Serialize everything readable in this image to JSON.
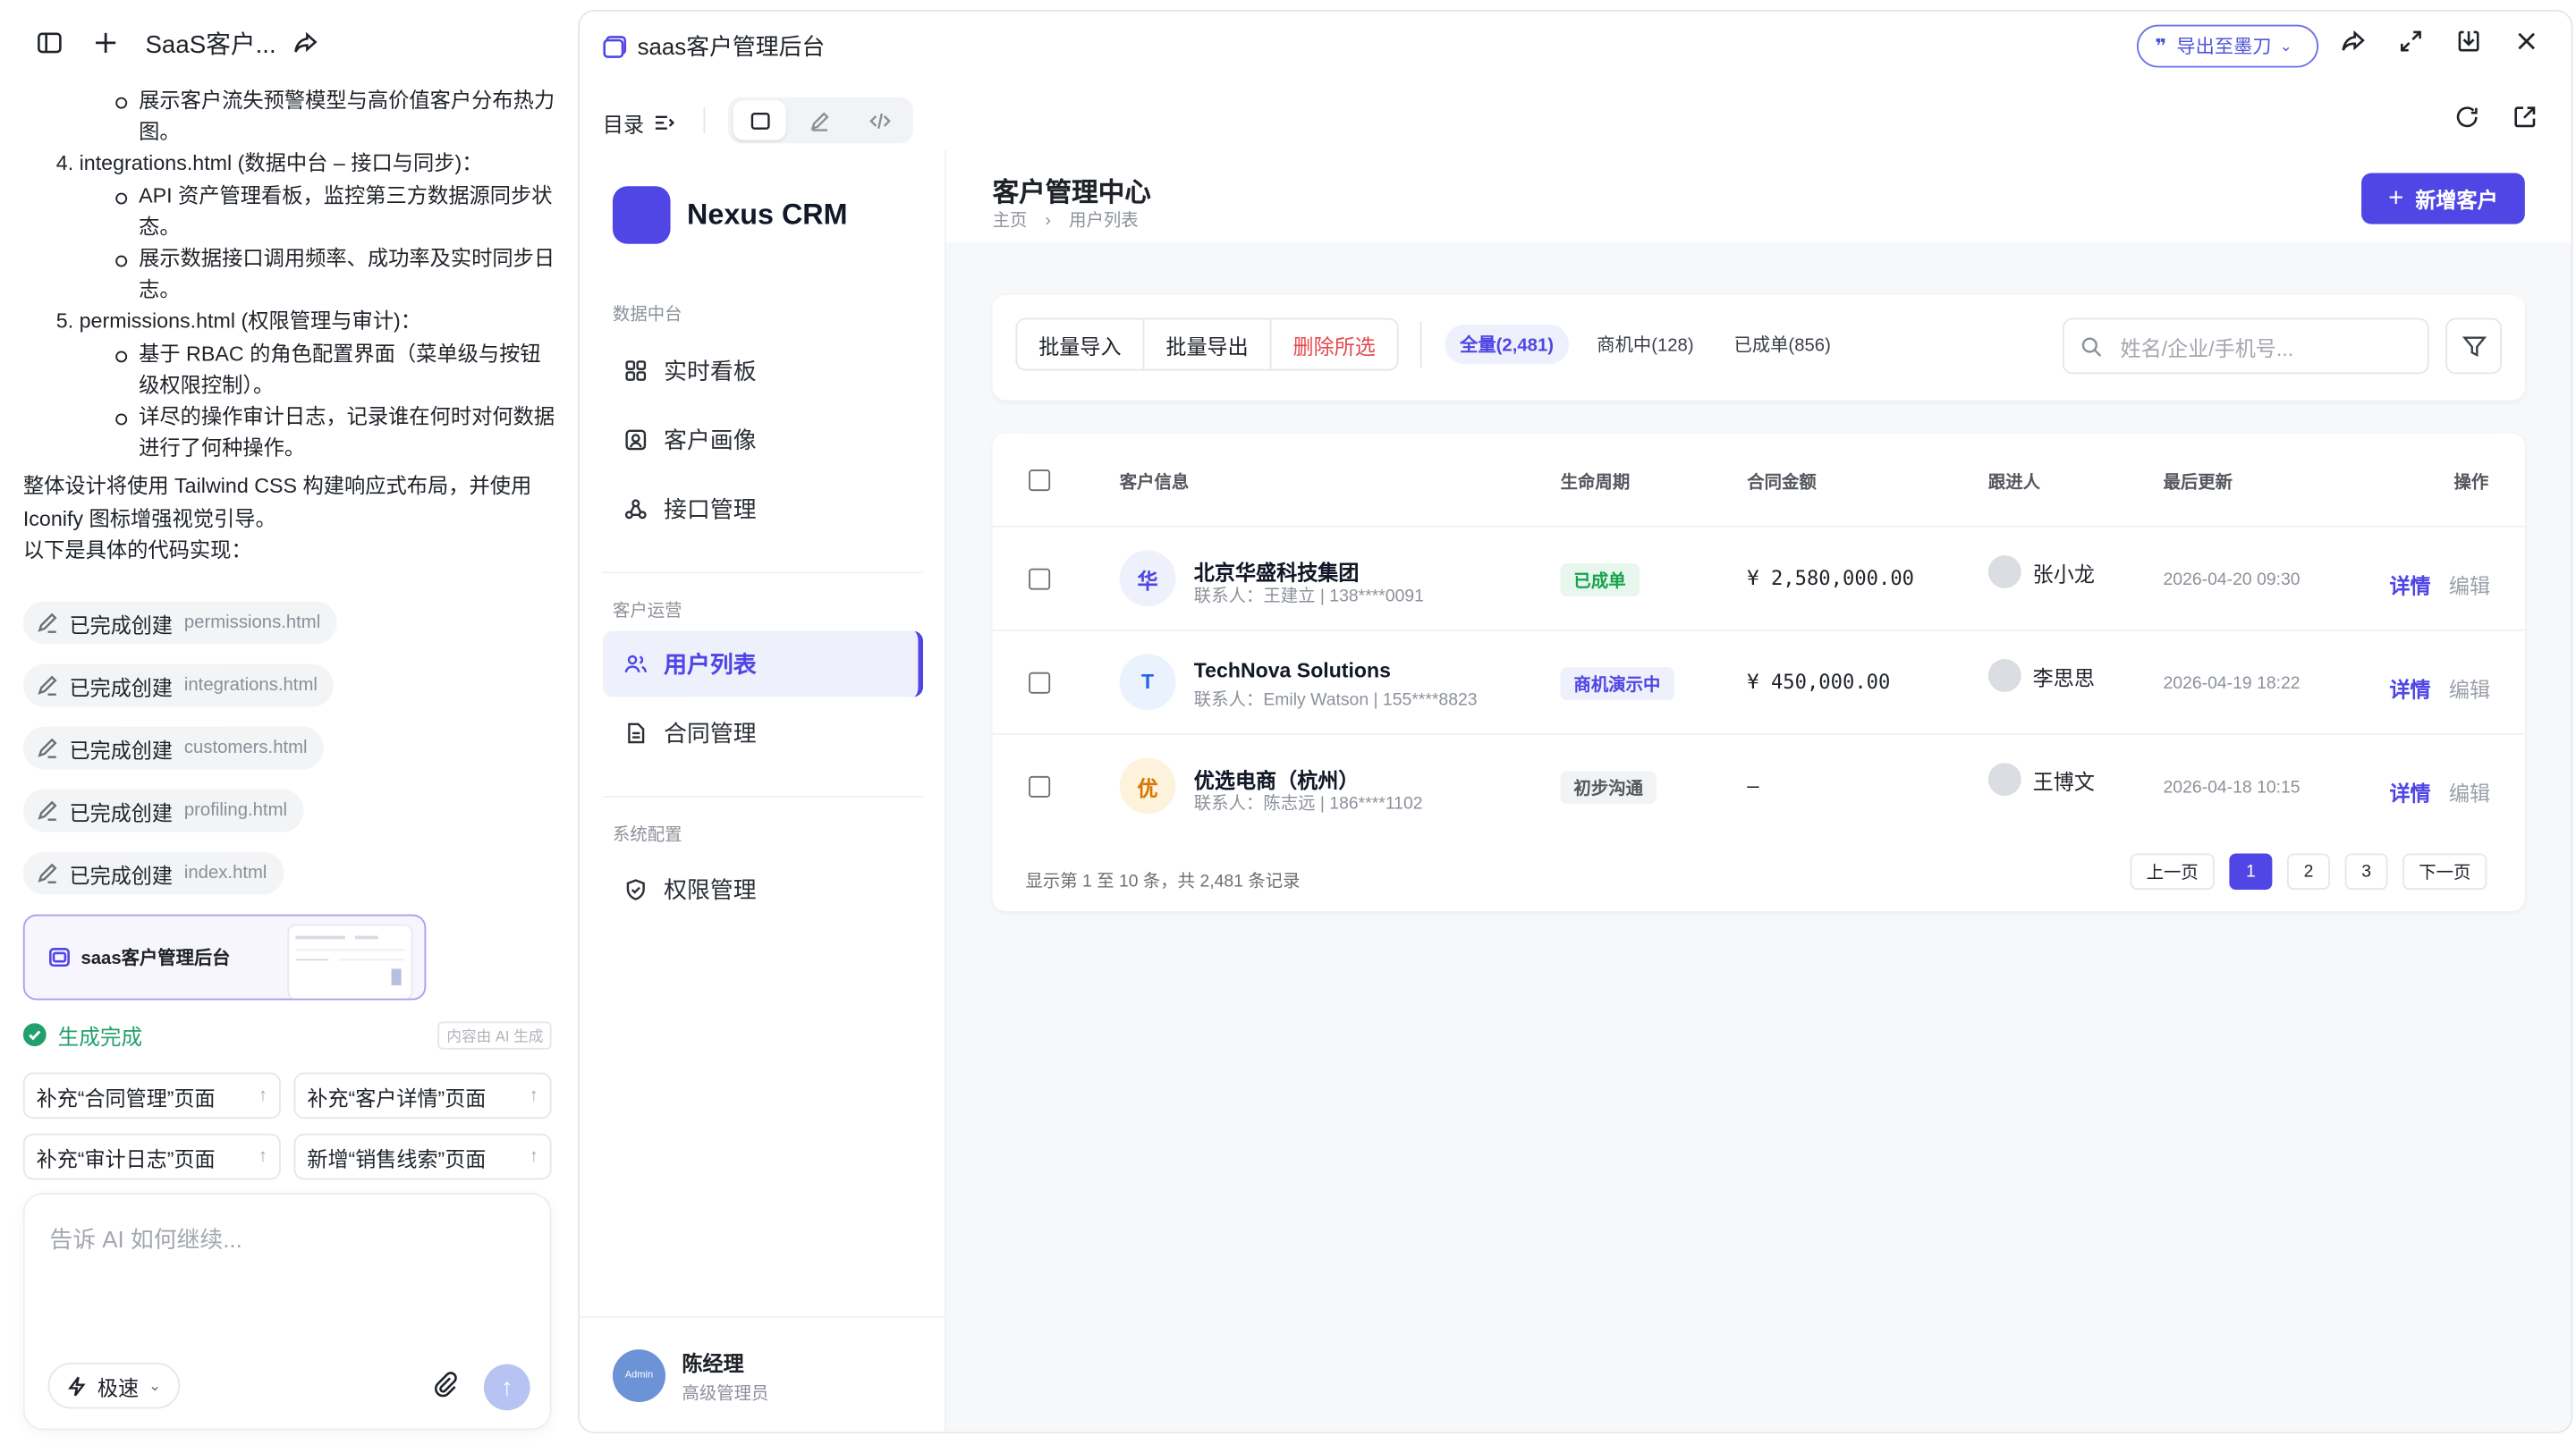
{
  "chat": {
    "title": "SaaS客户...",
    "bullets": [
      {
        "level": 2,
        "text": "展示客户流失预警模型与高价值客户分布热力图。"
      },
      {
        "level": 1,
        "text": "4. integrations.html (数据中台 – 接口与同步)："
      },
      {
        "level": 2,
        "text": "API 资产管理看板，监控第三方数据源同步状态。"
      },
      {
        "level": 2,
        "text": "展示数据接口调用频率、成功率及实时同步日志。"
      },
      {
        "level": 1,
        "text": "5. permissions.html (权限管理与审计)："
      },
      {
        "level": 2,
        "text": "基于 RBAC 的角色配置界面（菜单级与按钮级权限控制）。"
      },
      {
        "level": 2,
        "text": "详尽的操作审计日志，记录谁在何时对何数据进行了何种操作。"
      }
    ],
    "summary": "整体设计将使用 Tailwind CSS 构建响应式布局，并使用 Iconify 图标增强视觉引导。",
    "summary2": "以下是具体的代码实现：",
    "created_label": "已完成创建",
    "files": [
      "permissions.html",
      "integrations.html",
      "customers.html",
      "profiling.html",
      "index.html"
    ],
    "artifact_title": "saas客户管理后台",
    "done_text": "生成完成",
    "ai_tag": "内容由 AI 生成",
    "suggestions": [
      "补充“合同管理”页面",
      "补充“客户详情”页面",
      "补充“审计日志”页面",
      "新增“销售线索”页面"
    ],
    "input_placeholder": "告诉 AI 如何继续...",
    "mode_label": "极速"
  },
  "panel": {
    "title": "saas客户管理后台",
    "export_label": "导出至墨刀",
    "toc_label": "目录"
  },
  "app": {
    "brand": "Nexus CRM",
    "groups": [
      "数据中台",
      "客户运营",
      "系统配置"
    ],
    "nav": [
      {
        "label": "实时看板",
        "icon": "grid-icon"
      },
      {
        "label": "客户画像",
        "icon": "profile-icon"
      },
      {
        "label": "接口管理",
        "icon": "api-icon"
      },
      {
        "label": "用户列表",
        "icon": "users-icon"
      },
      {
        "label": "合同管理",
        "icon": "document-icon"
      },
      {
        "label": "权限管理",
        "icon": "shield-icon"
      }
    ],
    "user": {
      "avatar": "Admin",
      "name": "陈经理",
      "role": "高级管理员"
    },
    "page_title": "客户管理中心",
    "breadcrumb": [
      "主页",
      "用户列表"
    ],
    "add_button": "新增客户",
    "batch": [
      "批量导入",
      "批量导出",
      "删除所选"
    ],
    "filters": [
      "全量(2,481)",
      "商机中(128)",
      "已成单(856)"
    ],
    "search_placeholder": "姓名/企业/手机号...",
    "columns": [
      "客户信息",
      "生命周期",
      "合同金额",
      "跟进人",
      "最后更新",
      "操作"
    ],
    "rows": [
      {
        "initial": "华",
        "name": "北京华盛科技集团",
        "contact": "联系人：王建立 | 138****0091",
        "stage": "已成单",
        "amount": "¥ 2,580,000.00",
        "owner": "张小龙",
        "updated": "2026-04-20 09:30"
      },
      {
        "initial": "T",
        "name": "TechNova Solutions",
        "contact": "联系人：Emily Watson | 155****8823",
        "stage": "商机演示中",
        "amount": "¥ 450,000.00",
        "owner": "李思思",
        "updated": "2026-04-19 18:22"
      },
      {
        "initial": "优",
        "name": "优选电商（杭州）",
        "contact": "联系人：陈志远 | 186****1102",
        "stage": "初步沟通",
        "amount": "—",
        "owner": "王博文",
        "updated": "2026-04-18 10:15"
      }
    ],
    "action_detail": "详情",
    "action_edit": "编辑",
    "footer": "显示第 1 至 10 条，共 2,481 条记录",
    "pager": [
      "上一页",
      "1",
      "2",
      "3",
      "下一页"
    ],
    "colors": {
      "accent": "#4f46e5",
      "success": "#16a34a",
      "danger": "#e5484d"
    }
  }
}
